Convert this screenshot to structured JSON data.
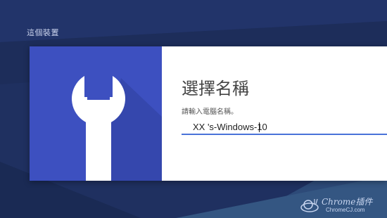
{
  "screen": {
    "device_label": "這個裝置",
    "background_color": "#1f3060"
  },
  "dialog": {
    "title": "選擇名稱",
    "field_label": "請輸入電腦名稱。",
    "name_value": "XX 's-Windows-10",
    "icon": "wrench-icon",
    "icon_panel_color": "#3d50c0",
    "input_underline_color": "#4a73d9"
  },
  "watermark": {
    "title": "Chrome插件",
    "url": "ChromeCJ.com",
    "icon": "snail-logo"
  }
}
